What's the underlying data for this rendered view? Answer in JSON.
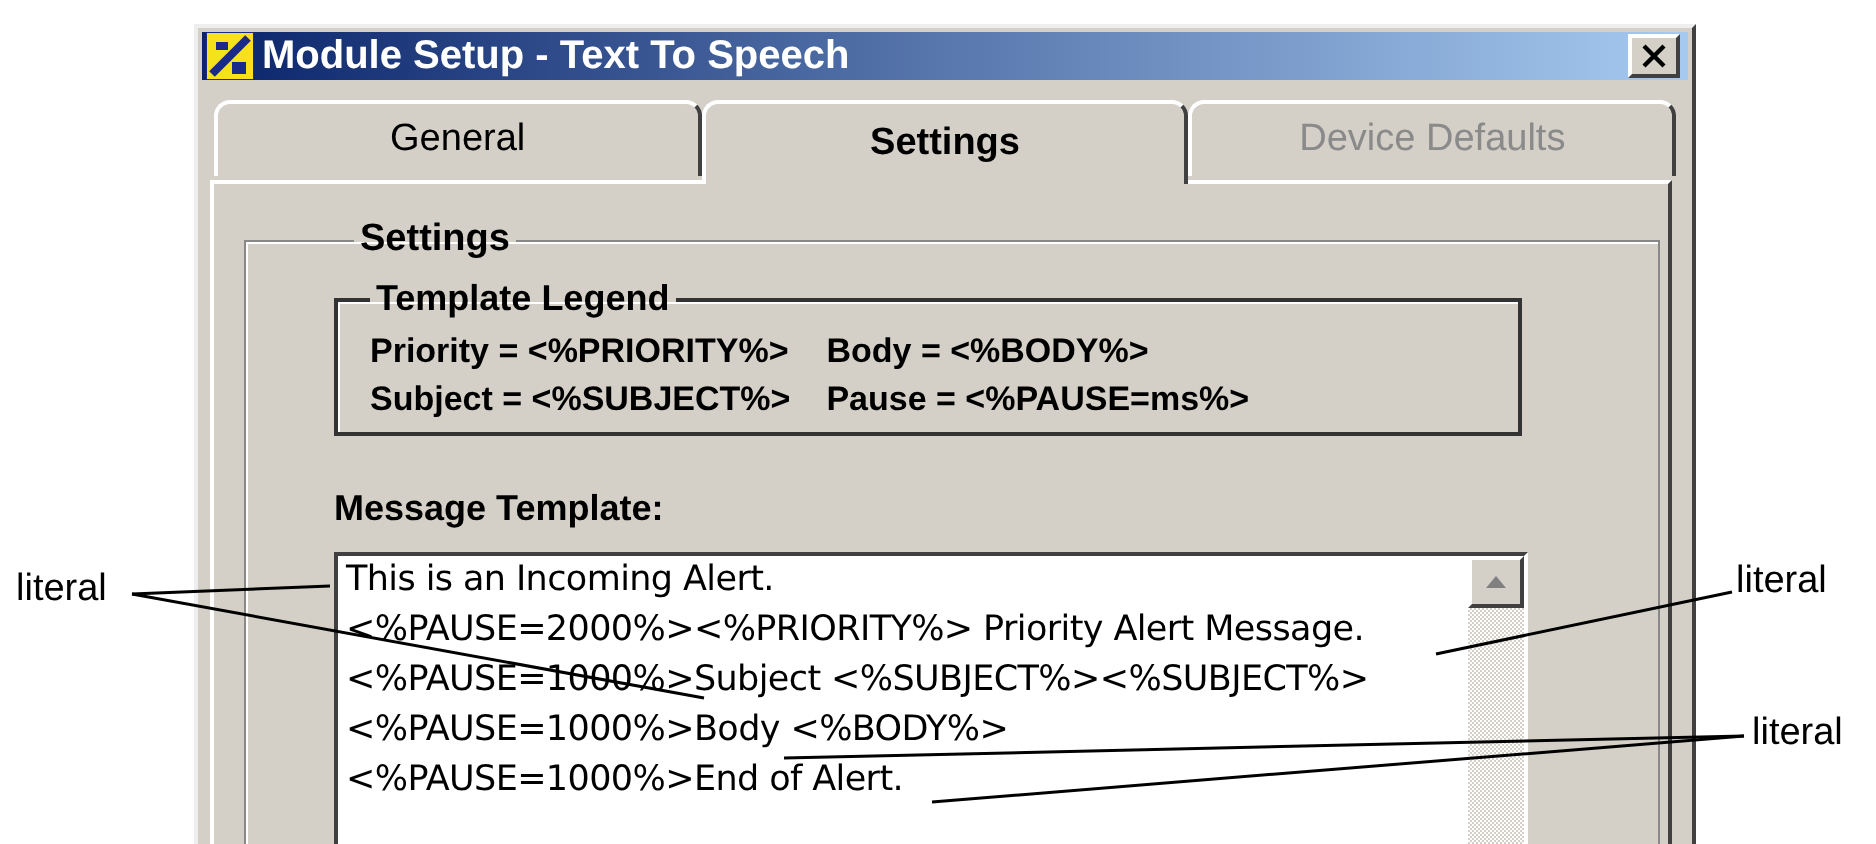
{
  "window": {
    "title": "Module Setup - Text To Speech"
  },
  "tabs": [
    {
      "label": "General",
      "selected": false,
      "disabled": false
    },
    {
      "label": "Settings",
      "selected": true,
      "disabled": false
    },
    {
      "label": "Device Defaults",
      "selected": false,
      "disabled": true
    }
  ],
  "settings": {
    "title": "Settings",
    "legend": {
      "title": "Template Legend",
      "rows": [
        [
          "Priority = <%PRIORITY%>",
          "Body = <%BODY%>"
        ],
        [
          "Subject = <%SUBJECT%>",
          "Pause = <%PAUSE=ms%>"
        ]
      ]
    },
    "template_label": "Message Template:",
    "template_lines": [
      "This is an Incoming Alert.",
      "<%PAUSE=2000%><%PRIORITY%> Priority Alert Message.",
      "<%PAUSE=1000%>Subject <%SUBJECT%><%SUBJECT%>",
      "<%PAUSE=1000%>Body <%BODY%>",
      "<%PAUSE=1000%>End of Alert."
    ]
  },
  "annotations": [
    {
      "label": "literal"
    },
    {
      "label": "literal"
    },
    {
      "label": "literal"
    }
  ]
}
